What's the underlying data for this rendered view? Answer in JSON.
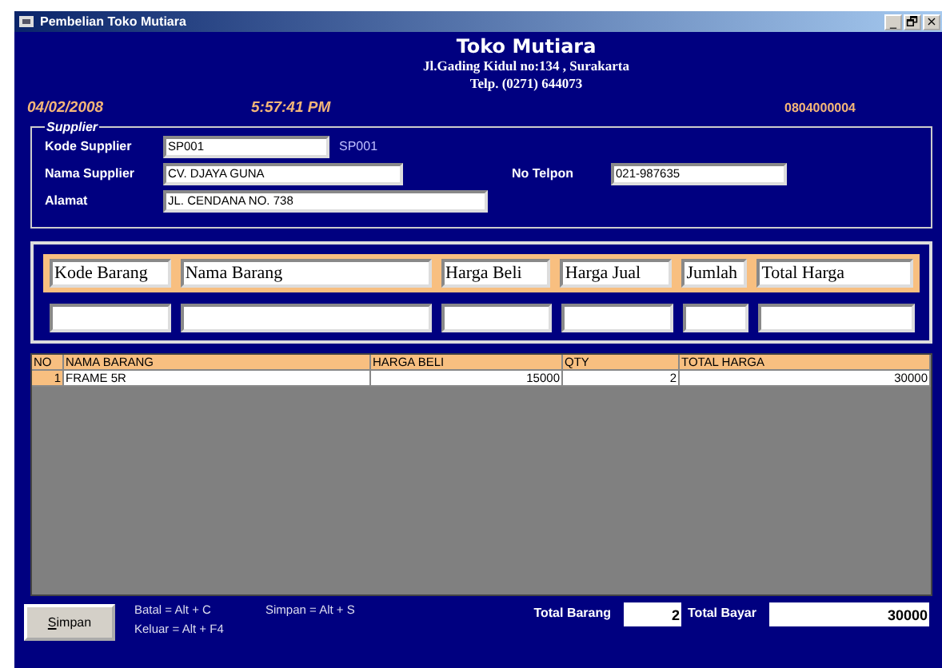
{
  "window": {
    "title": "Pembelian Toko Mutiara",
    "controls": [
      "_",
      "🗗",
      "×"
    ]
  },
  "header": {
    "store_name": "Toko Mutiara",
    "address": "Jl.Gading Kidul no:134 , Surakarta",
    "phone": "Telp. (0271) 644073"
  },
  "date": "04/02/2008",
  "time": "5:57:41 PM",
  "invoice_number": "0804000004",
  "supplier": {
    "legend": "Supplier",
    "code_label": "Kode Supplier",
    "code_value": "SP001",
    "code_echo": "SP001",
    "name_label": "Nama Supplier",
    "name_value": "CV. DJAYA GUNA",
    "phone_label": "No Telpon",
    "phone_value": "021-987635",
    "address_label": "Alamat",
    "address_value": "JL. CENDANA NO. 738"
  },
  "item_entry": {
    "columns": [
      "Kode Barang",
      "Nama Barang",
      "Harga Beli",
      "Harga Jual",
      "Jumlah",
      "Total Harga"
    ]
  },
  "table": {
    "columns": [
      "NO",
      "NAMA BARANG",
      "HARGA BELI",
      "QTY",
      "TOTAL HARGA"
    ],
    "rows": [
      {
        "no": "1",
        "name": "FRAME 5R",
        "price": "15000",
        "qty": "2",
        "total": "30000"
      }
    ]
  },
  "footer": {
    "button": "Simpan",
    "hints": [
      "Batal = Alt + C",
      "Simpan = Alt + S",
      "Keluar = Alt + F4"
    ],
    "total_items_label": "Total Barang",
    "total_items": "2",
    "total_pay_label": "Total Bayar",
    "total_pay": "30000"
  }
}
